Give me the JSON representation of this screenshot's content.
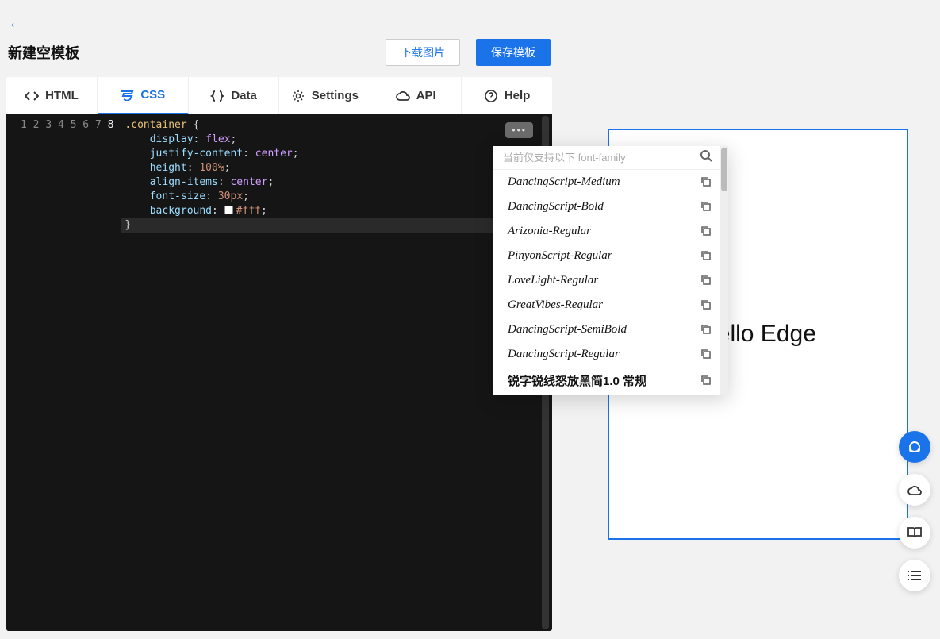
{
  "header": {
    "title": "新建空模板",
    "download_label": "下载图片",
    "save_label": "保存模板"
  },
  "tabs": [
    {
      "label": "HTML"
    },
    {
      "label": "CSS"
    },
    {
      "label": "Data"
    },
    {
      "label": "Settings"
    },
    {
      "label": "API"
    },
    {
      "label": "Help"
    }
  ],
  "editor": {
    "lines": {
      "l1_sel": ".container",
      "l1_brace": " {",
      "l2_prop": "display",
      "l2_val": "flex",
      "l3_prop": "justify-content",
      "l3_val": "center",
      "l4_prop": "height",
      "l4_val": "100%",
      "l5_prop": "align-items",
      "l5_val": "center",
      "l6_prop": "font-size",
      "l6_val": "30px",
      "l7_prop": "background",
      "l7_val": "#fff",
      "l8": "}"
    },
    "line_numbers": [
      "1",
      "2",
      "3",
      "4",
      "5",
      "6",
      "7",
      "8"
    ],
    "more": "•••"
  },
  "font_picker": {
    "placeholder": "当前仅支持以下 font-family",
    "items": [
      "DancingScript-Medium",
      "DancingScript-Bold",
      "Arizonia-Regular",
      "PinyonScript-Regular",
      "LoveLight-Regular",
      "GreatVibes-Regular",
      "DancingScript-SemiBold",
      "DancingScript-Regular",
      "锐字锐线怒放黑简1.0 常规"
    ]
  },
  "preview": {
    "text": "Hello Edge"
  }
}
